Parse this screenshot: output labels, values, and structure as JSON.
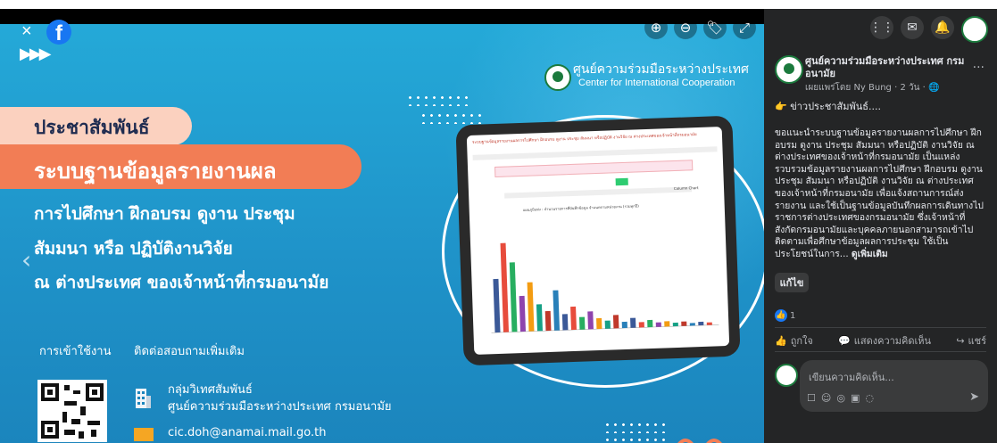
{
  "viewer": {
    "close_icon": "×",
    "brand_icon": "f",
    "zoom_in_icon": "⊕",
    "zoom_out_icon": "⊖",
    "tag_icon": "🏷",
    "fullscreen_icon": "⤢"
  },
  "poster": {
    "dept_th": "ศูนย์ความร่วมมือระหว่างประเทศ",
    "dept_en": "Center for International Cooperation",
    "pr_label": "ประชาสัมพันธ์",
    "headline": "ระบบฐานข้อมูลรายงานผล",
    "line1": "การไปศึกษา ฝึกอบรม ดูงาน ประชุม",
    "line2": "สัมมนา หรือ ปฏิบัติงานวิจัย",
    "line3": "ณ ต่างประเทศ ของเจ้าหน้าที่กรมอนามัย",
    "usage_label": "การเข้าใช้งาน",
    "contact_label": "ติดต่อสอบถามเพิ่มเติม",
    "contact_group": "กลุ่มวิเทศสัมพันธ์",
    "contact_center": "ศูนย์ความร่วมมือระหว่างประเทศ กรมอนามัย",
    "contact_email": "cic.doh@anamai.mail.go.th",
    "screen_title": "ระบบฐานข้อมูลรายงานผลการไปศึกษา ฝึกอบรม ดูงาน ประชุม สัมมนา หรือปฏิบัติ งานวิจัย ณ ต่างประเทศของเจ้าหน้าที่กรมอนามัย",
    "screen_chart_type": "Column Chart",
    "screen_chart_caption": "แผนภูมิแท่ง : จำนวนรายการที่บันทึกข้อมูล จำแนกตามหน่วยงาน (รวมทุกปี)"
  },
  "sidebar": {
    "page_name": "ศูนย์ความร่วมมือระหว่างประเทศ กรมอนามัย",
    "meta": "เผยแพร่โดย Ny Bung  · 2 วัน · ",
    "more": "···",
    "teaser": "👉 ข่าวประชาสัมพันธ์....",
    "body": "ขอแนะนำระบบฐานข้อมูลรายงานผลการไปศึกษา ฝึกอบรม ดูงาน ประชุม สัมมนา หรือปฏิบัติ งานวิจัย ณ ต่างประเทศของเจ้าหน้าที่กรมอนามัย เป็นแหล่งรวบรวมข้อมูลรายงานผลการไปศึกษา ฝึกอบรม ดูงาน ประชุม สัมมนา หรือปฏิบัติ งานวิจัย ณ ต่างประเทศของเจ้าหน้าที่กรมอนามัย เพื่อแจ้งสถานการณ์ส่งรายงาน และใช้เป็นฐานข้อมูลบันทึกผลการเดินทางไปราชการต่างประเทศของกรมอนามัย ซึ่งเจ้าหน้าที่สังกัดกรมอนามัยและบุคคลภายนอกสามารถเข้าไปติดตามเพื่อศึกษาข้อมูลผลการประชุม ใช้เป็นประโยชน์ในการ...",
    "see_more": "ดูเพิ่มเติม",
    "edit_label": "แก้ไข",
    "like_count": "1",
    "like_action": "ถูกใจ",
    "comment_action": "แสดงความคิดเห็น",
    "share_action": "แชร์",
    "comment_placeholder": "เขียนความคิดเห็น..."
  }
}
